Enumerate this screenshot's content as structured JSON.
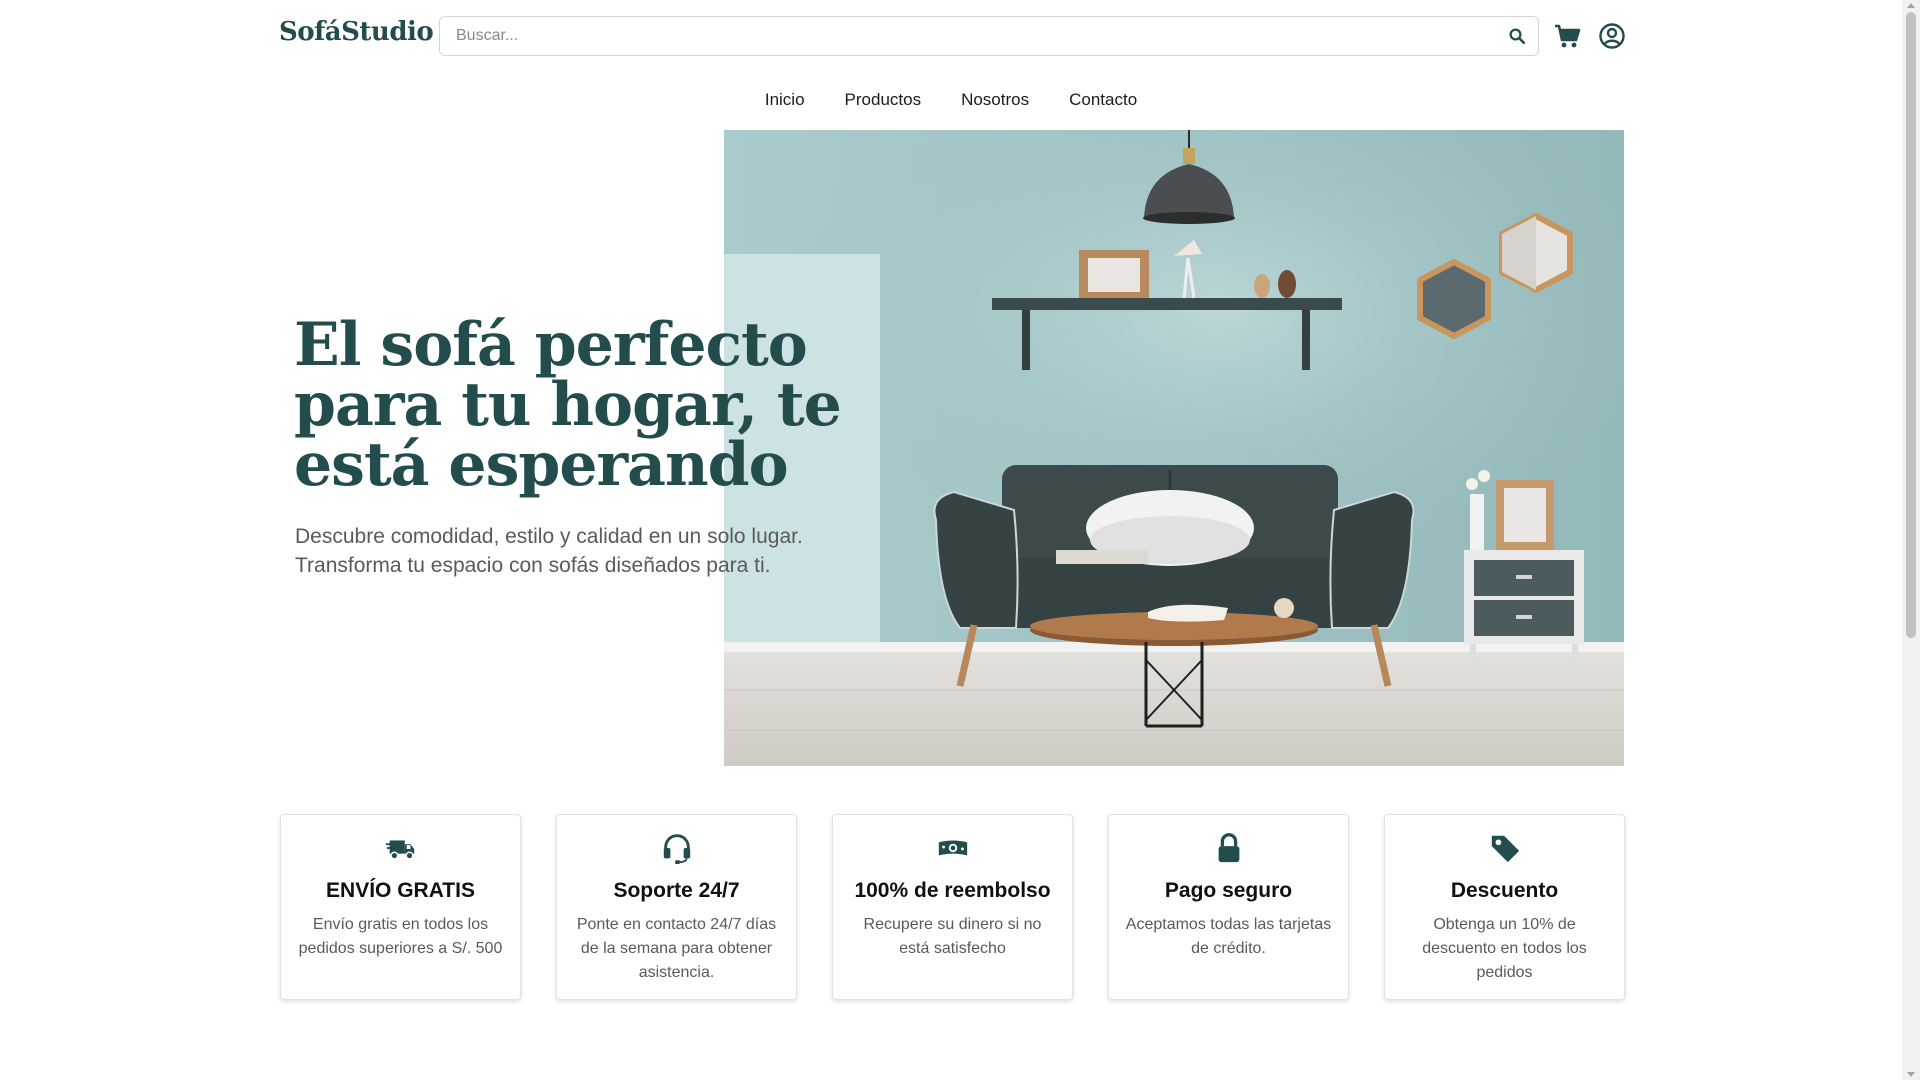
{
  "header": {
    "logo": "SofáStudio",
    "search_placeholder": "Buscar...",
    "icons": [
      "search-icon",
      "cart-icon",
      "user-icon"
    ]
  },
  "nav": {
    "items": [
      "Inicio",
      "Productos",
      "Nosotros",
      "Contacto"
    ]
  },
  "hero": {
    "title": "El sofá perfecto para tu hogar, te está esperando",
    "subtitle": "Descubre comodidad, estilo y calidad en un solo lugar. Transforma tu espacio con sofás diseñados para ti."
  },
  "features": [
    {
      "icon": "truck-icon",
      "title": "ENVÍO GRATIS",
      "text": "Envío gratis en todos los pedidos superiores a S/. 500"
    },
    {
      "icon": "headset-icon",
      "title": "Soporte 24/7",
      "text": "Ponte en contacto 24/7 días de la semana para obtener asistencia."
    },
    {
      "icon": "money-icon",
      "title": "100% de reembolso",
      "text": "Recupere su dinero si no está satisfecho"
    },
    {
      "icon": "lock-icon",
      "title": "Pago seguro",
      "text": "Aceptamos todas las tarjetas de crédito."
    },
    {
      "icon": "tag-icon",
      "title": "Descuento",
      "text": "Obtenga un 10% de descuento en todos los pedidos"
    }
  ],
  "colors": {
    "brand": "#234d4d",
    "wall": "#9cc0c2",
    "sofa": "#3b4748",
    "floor": "#d9d6d1"
  }
}
